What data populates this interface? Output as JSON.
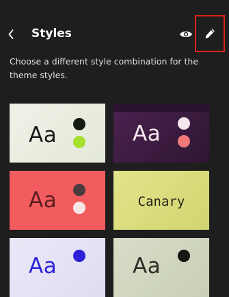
{
  "header": {
    "title": "Styles",
    "description": "Choose a different style combination for the theme styles."
  },
  "icons": {
    "back": "chevron-left-icon",
    "preview": "eye-icon",
    "edit": "pencil-icon"
  },
  "highlight_color": "#e0201b",
  "styles": [
    {
      "label": "Aa",
      "bg": "#eff1e6",
      "text": "#1a1a1a",
      "dots": [
        "#151a10",
        "#a6e02e"
      ]
    },
    {
      "label": "Aa",
      "bg": "#4b2250",
      "text": "#f7e8ef",
      "dots": [
        "#f7e8ef",
        "#f2797a"
      ]
    },
    {
      "label": "Aa",
      "bg": "#f25c5f",
      "text": "#5a1e20",
      "dots": [
        "#4a3b3c",
        "#f8e6e6"
      ]
    },
    {
      "label": "Canary",
      "bg": "#e2e38a",
      "text": "#22231a",
      "dots": []
    },
    {
      "label": "Aa",
      "bg": "#eae8f7",
      "text": "#2d22d8",
      "dots": [
        "#2d22d8"
      ]
    },
    {
      "label": "Aa",
      "bg": "#d8ddc8",
      "text": "#2a2e26",
      "dots": [
        "#151515"
      ]
    }
  ]
}
